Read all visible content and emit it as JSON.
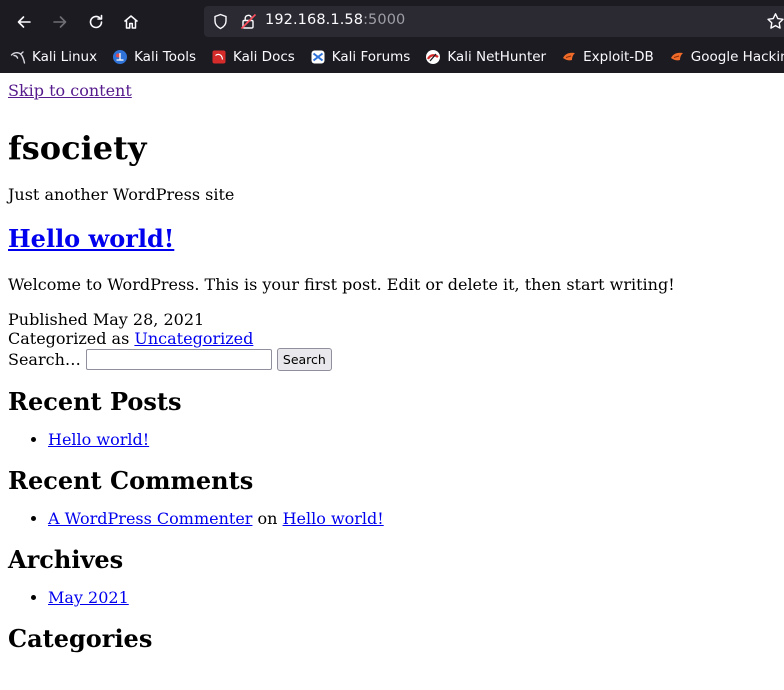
{
  "browser": {
    "url_host": "192.168.1.58",
    "url_port": ":5000",
    "bookmarks": [
      {
        "label": "Kali Linux",
        "icon": "kali-dragon-icon"
      },
      {
        "label": "Kali Tools",
        "icon": "kali-tools-icon"
      },
      {
        "label": "Kali Docs",
        "icon": "kali-docs-icon"
      },
      {
        "label": "Kali Forums",
        "icon": "kali-forums-icon"
      },
      {
        "label": "Kali NetHunter",
        "icon": "kali-nethunter-icon"
      },
      {
        "label": "Exploit-DB",
        "icon": "exploit-db-icon"
      },
      {
        "label": "Google Hacking DB",
        "icon": "ghdb-icon"
      }
    ]
  },
  "page": {
    "skip_link": "Skip to content",
    "site_title": "fsociety",
    "tagline": "Just another WordPress site",
    "post": {
      "title": "Hello world!",
      "content": "Welcome to WordPress. This is your first post. Edit or delete it, then start writing!",
      "published_label": "Published",
      "published_date": "May 28, 2021",
      "categorized_label": "Categorized as",
      "category": "Uncategorized"
    },
    "search": {
      "label": "Search…",
      "value": "",
      "button": "Search"
    },
    "recent_posts": {
      "title": "Recent Posts",
      "items": [
        "Hello world!"
      ]
    },
    "recent_comments": {
      "title": "Recent Comments",
      "author": "A WordPress Commenter",
      "on": "on",
      "post": "Hello world!"
    },
    "archives": {
      "title": "Archives",
      "items": [
        "May 2021"
      ]
    },
    "categories": {
      "title": "Categories"
    }
  }
}
